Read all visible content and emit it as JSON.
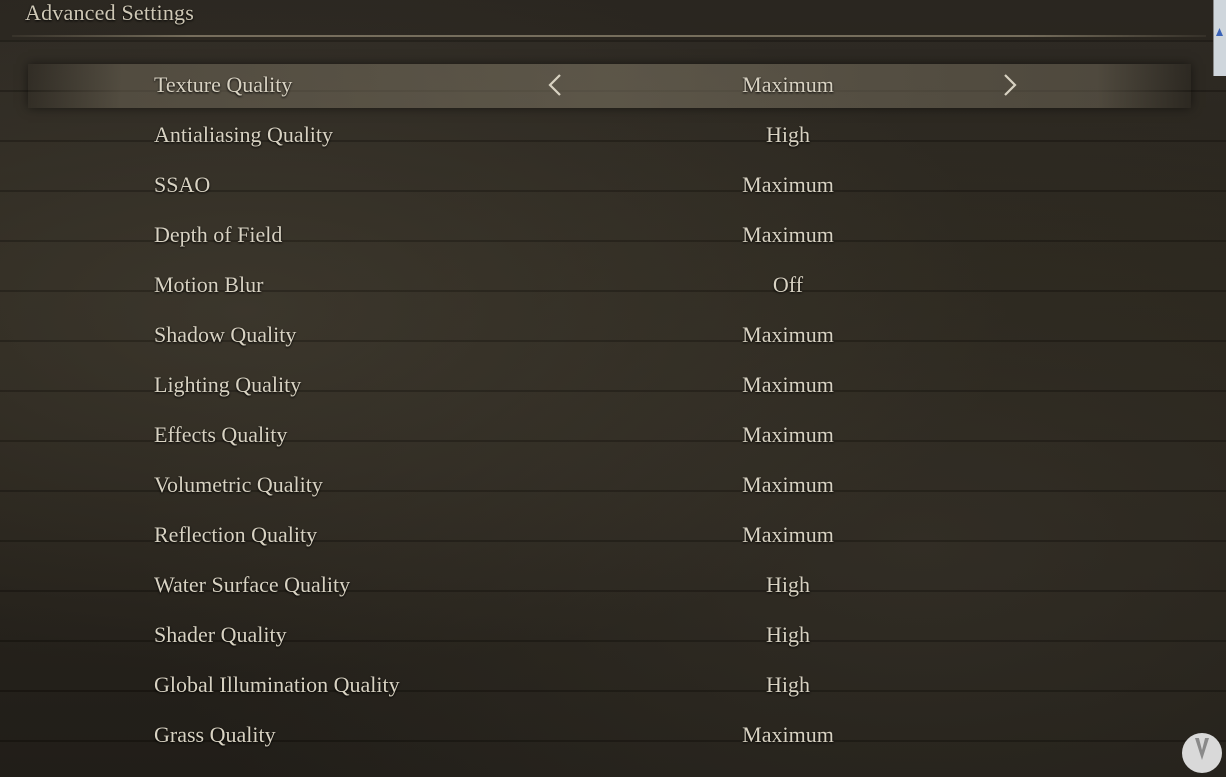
{
  "header": {
    "title": "Advanced Settings"
  },
  "settings": [
    {
      "label": "Texture Quality",
      "value": "Maximum"
    },
    {
      "label": "Antialiasing Quality",
      "value": "High"
    },
    {
      "label": "SSAO",
      "value": "Maximum"
    },
    {
      "label": "Depth of Field",
      "value": "Maximum"
    },
    {
      "label": "Motion Blur",
      "value": "Off"
    },
    {
      "label": "Shadow Quality",
      "value": "Maximum"
    },
    {
      "label": "Lighting Quality",
      "value": "Maximum"
    },
    {
      "label": "Effects Quality",
      "value": "Maximum"
    },
    {
      "label": "Volumetric Quality",
      "value": "Maximum"
    },
    {
      "label": "Reflection Quality",
      "value": "Maximum"
    },
    {
      "label": "Water Surface Quality",
      "value": "High"
    },
    {
      "label": "Shader Quality",
      "value": "High"
    },
    {
      "label": "Global Illumination Quality",
      "value": "High"
    },
    {
      "label": "Grass Quality",
      "value": "Maximum"
    }
  ],
  "selected_index": 0,
  "icons": {
    "prev": "chevron-left-icon",
    "next": "chevron-right-icon",
    "watermark": "vandal-logo-icon"
  },
  "colors": {
    "text": "#d8d2c2",
    "background": "#24201a",
    "highlight": "#7a725f"
  }
}
